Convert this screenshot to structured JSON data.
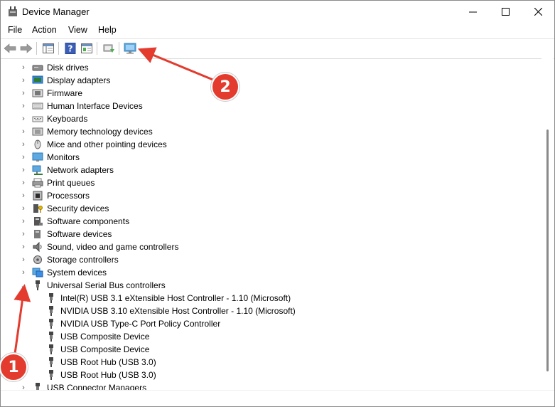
{
  "window": {
    "title": "Device Manager"
  },
  "menu": [
    "File",
    "Action",
    "View",
    "Help"
  ],
  "tree": {
    "categories": [
      {
        "label": "Disk drives",
        "icon": "disk-drive-icon"
      },
      {
        "label": "Display adapters",
        "icon": "display-adapter-icon"
      },
      {
        "label": "Firmware",
        "icon": "firmware-icon"
      },
      {
        "label": "Human Interface Devices",
        "icon": "hid-icon"
      },
      {
        "label": "Keyboards",
        "icon": "keyboard-icon"
      },
      {
        "label": "Memory technology devices",
        "icon": "memory-icon"
      },
      {
        "label": "Mice and other pointing devices",
        "icon": "mouse-icon"
      },
      {
        "label": "Monitors",
        "icon": "monitor-icon"
      },
      {
        "label": "Network adapters",
        "icon": "network-adapter-icon"
      },
      {
        "label": "Print queues",
        "icon": "printer-icon"
      },
      {
        "label": "Processors",
        "icon": "processor-icon"
      },
      {
        "label": "Security devices",
        "icon": "security-device-icon"
      },
      {
        "label": "Software components",
        "icon": "software-component-icon"
      },
      {
        "label": "Software devices",
        "icon": "software-device-icon"
      },
      {
        "label": "Sound, video and game controllers",
        "icon": "speaker-icon"
      },
      {
        "label": "Storage controllers",
        "icon": "storage-controller-icon"
      },
      {
        "label": "System devices",
        "icon": "system-device-icon"
      }
    ],
    "usb": {
      "label": "Universal Serial Bus controllers",
      "expanded": true,
      "children": [
        "Intel(R) USB 3.1 eXtensible Host Controller - 1.10 (Microsoft)",
        "NVIDIA USB 3.10 eXtensible Host Controller - 1.10 (Microsoft)",
        "NVIDIA USB Type-C Port Policy Controller",
        "USB Composite Device",
        "USB Composite Device",
        "USB Root Hub (USB 3.0)",
        "USB Root Hub (USB 3.0)"
      ]
    },
    "partial": {
      "label": "USB Connector Managers"
    }
  },
  "annotations": [
    "1",
    "2"
  ],
  "colors": {
    "annotation": "#e33b2e"
  }
}
